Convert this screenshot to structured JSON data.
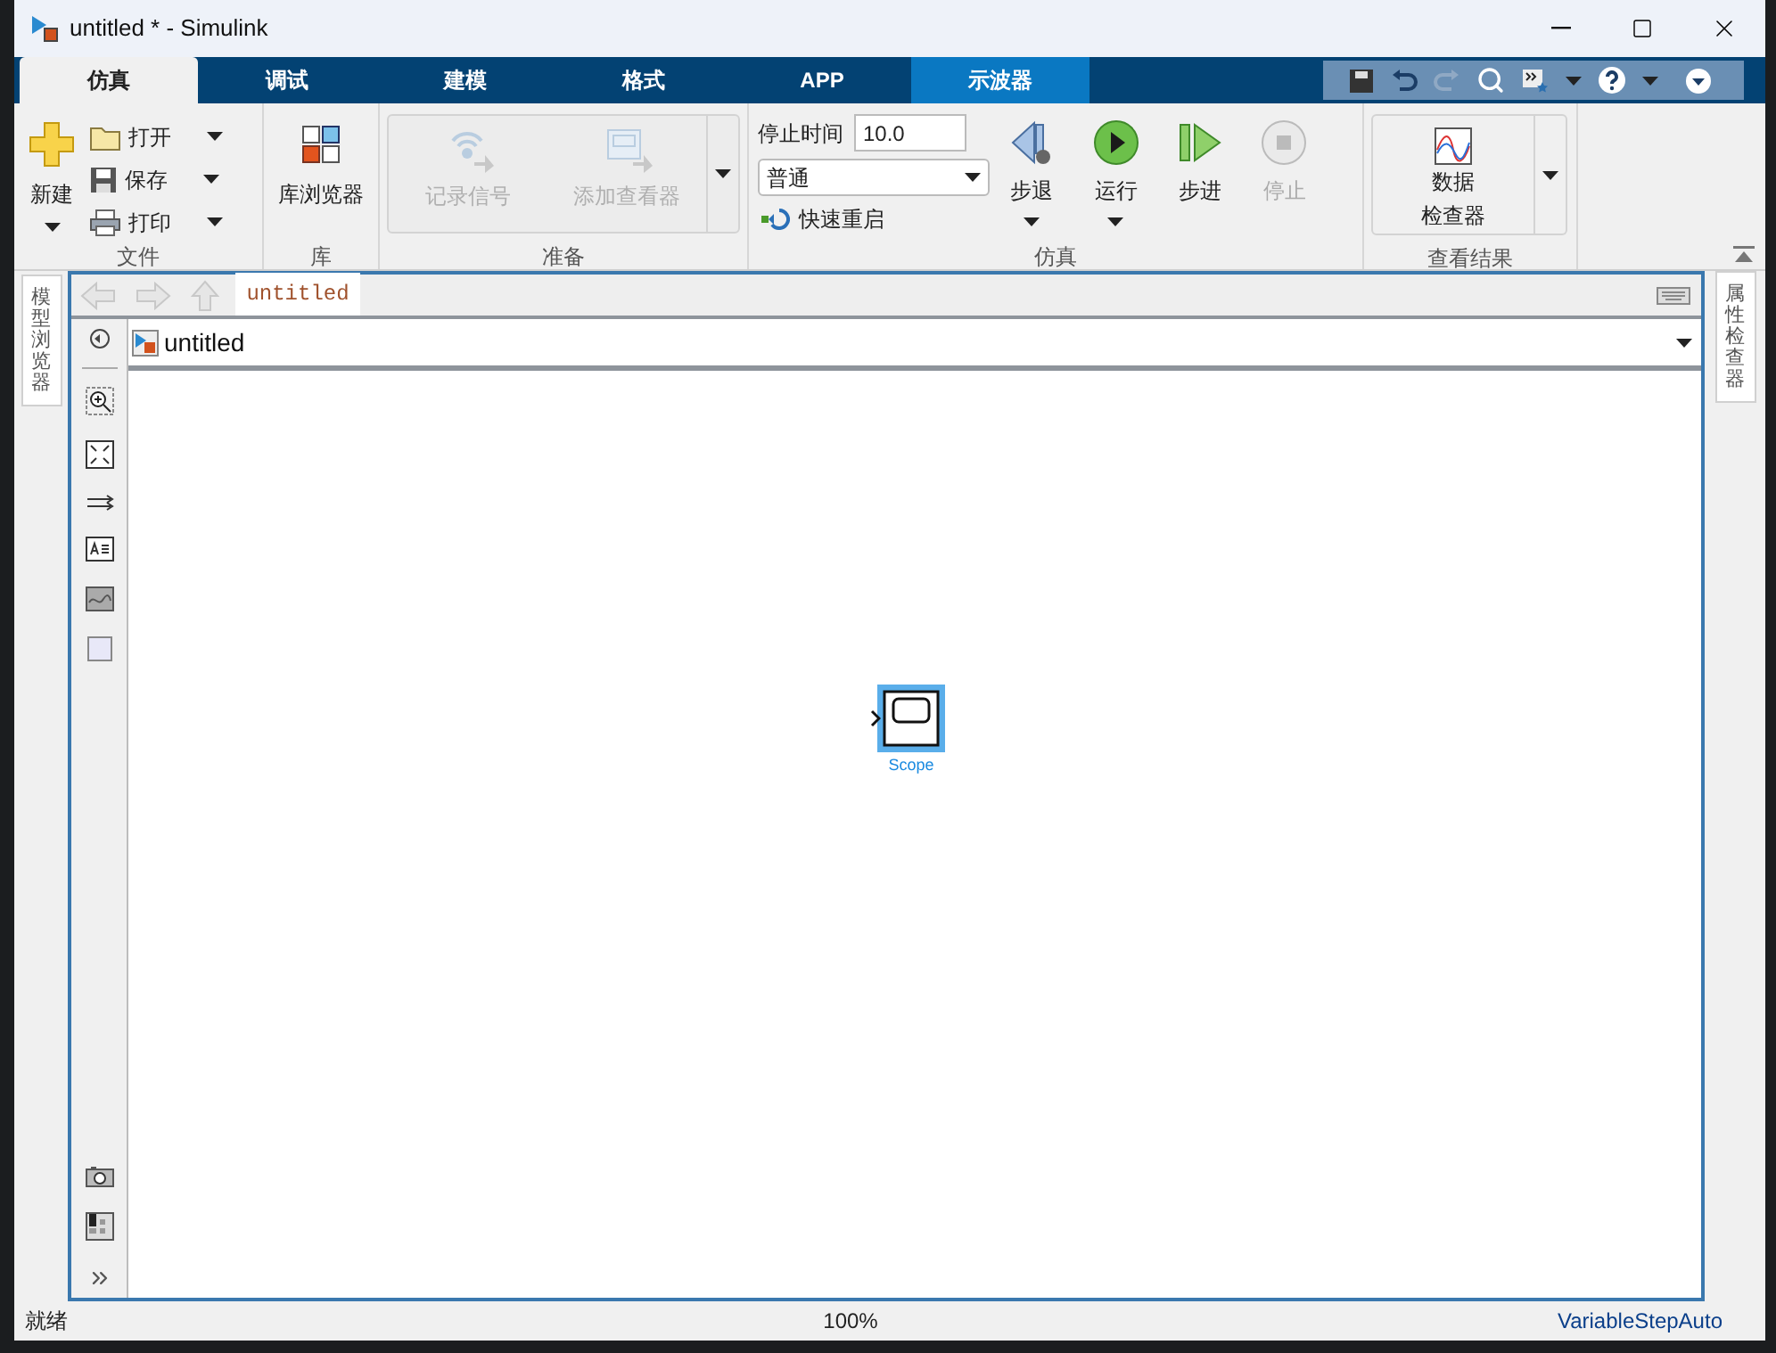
{
  "window": {
    "title": "untitled * - Simulink"
  },
  "tabs": [
    {
      "label": "仿真",
      "selected": true,
      "kind": "normal"
    },
    {
      "label": "调试",
      "selected": false,
      "kind": "normal"
    },
    {
      "label": "建模",
      "selected": false,
      "kind": "normal"
    },
    {
      "label": "格式",
      "selected": false,
      "kind": "normal"
    },
    {
      "label": "APP",
      "selected": false,
      "kind": "normal"
    },
    {
      "label": "示波器",
      "selected": false,
      "kind": "contextual"
    }
  ],
  "ribbon": {
    "file": {
      "label": "文件",
      "new": "新建",
      "items": [
        {
          "label": "打开",
          "kind": "open"
        },
        {
          "label": "保存",
          "kind": "save"
        },
        {
          "label": "打印",
          "kind": "print"
        }
      ]
    },
    "library": {
      "label": "库",
      "button": "库浏览器"
    },
    "prepare": {
      "label": "准备",
      "buttons": [
        {
          "label": "记录信号",
          "disabled": true,
          "kind": "log"
        },
        {
          "label": "添加查看器",
          "disabled": true,
          "kind": "viewer"
        }
      ]
    },
    "simulation": {
      "label": "仿真",
      "stop_time_label": "停止时间",
      "stop_time": "10.0",
      "mode": "普通",
      "fast_restart": "快速重启",
      "buttons": [
        {
          "label": "步退",
          "kind": "back",
          "disabled": false,
          "menu": true
        },
        {
          "label": "运行",
          "kind": "run",
          "disabled": false,
          "menu": true
        },
        {
          "label": "步进",
          "kind": "forward",
          "disabled": false,
          "menu": false
        },
        {
          "label": "停止",
          "kind": "stop",
          "disabled": true,
          "menu": false
        }
      ]
    },
    "results": {
      "label": "查看结果",
      "button": [
        "数据",
        "检查器"
      ]
    }
  },
  "left_panel": {
    "tab": "模型浏览器"
  },
  "right_panel": {
    "tab": "属性检查器"
  },
  "editor": {
    "tab": "untitled",
    "breadcrumb": "untitled",
    "block": {
      "label": "Scope",
      "selected": true
    }
  },
  "status_bar": {
    "status": "就绪",
    "zoom": "100%",
    "solver": "VariableStepAuto"
  }
}
